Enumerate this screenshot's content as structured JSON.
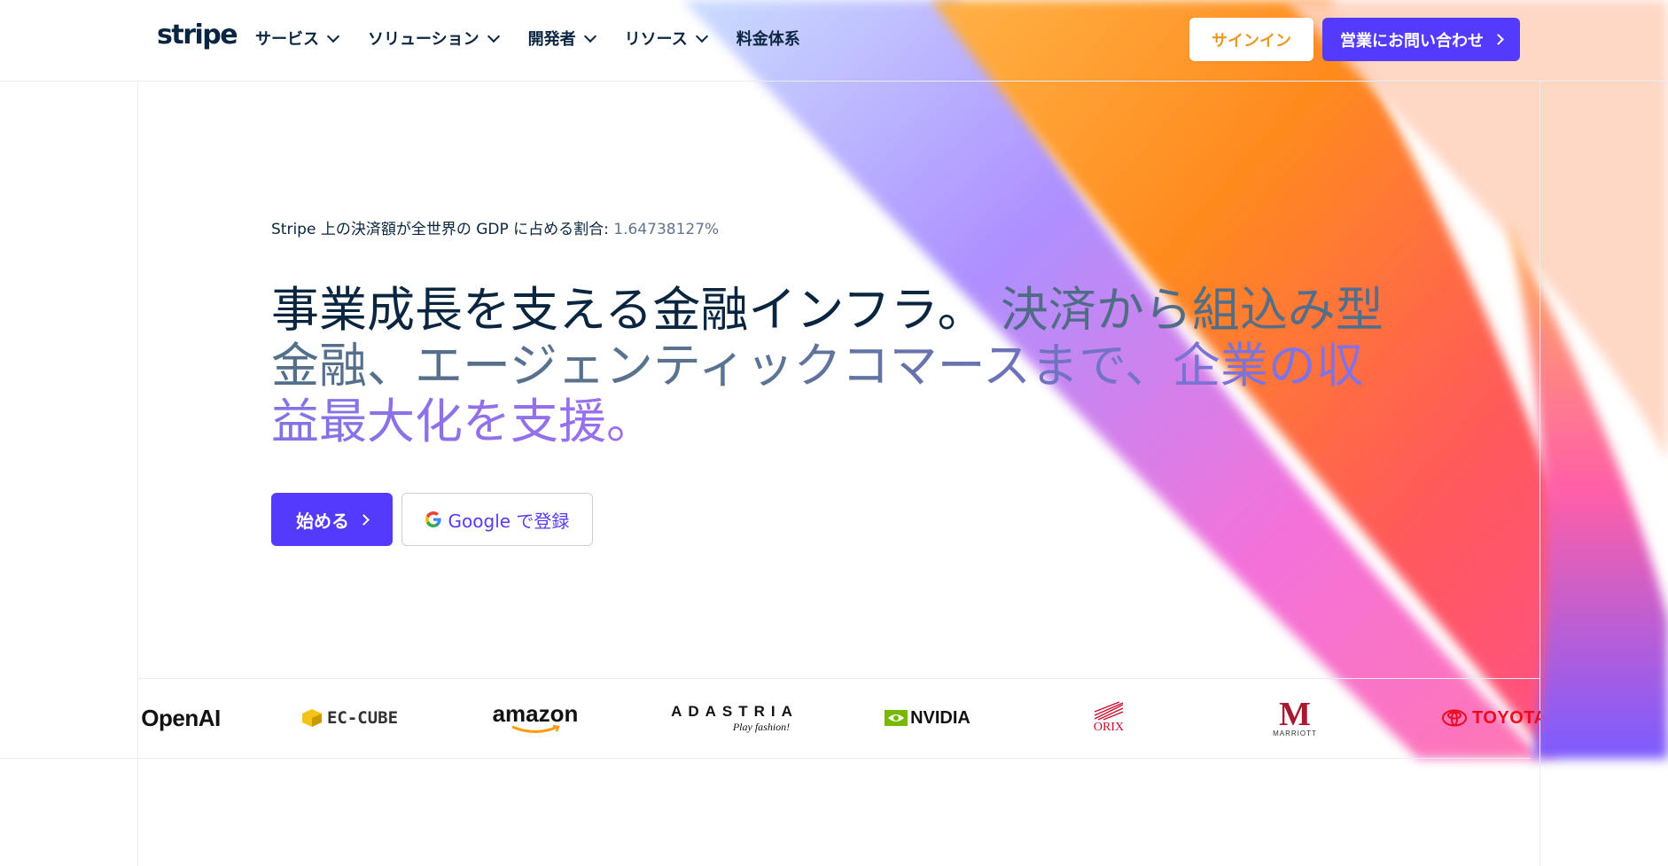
{
  "header": {
    "logo": "stripe",
    "nav": [
      {
        "label": "サービス"
      },
      {
        "label": "ソリューション"
      },
      {
        "label": "開発者"
      },
      {
        "label": "リソース"
      },
      {
        "label": "料金体系"
      }
    ],
    "signin_label": "サインイン",
    "contact_label": "営業にお問い合わせ"
  },
  "hero": {
    "gdp_label": "Stripe 上の決済額が全世界の GDP に占める割合:",
    "gdp_value": "1.64738127%",
    "headline_dark": "事業成長を支える金融インフラ。",
    "headline_light": "決済から組込み型金融、エージェンティックコマースまで、企業の収益最大化を支援。",
    "start_label": "始める",
    "google_label": "Google で登録"
  },
  "logos": [
    "OpenAI",
    "EC-CUBE",
    "amazon",
    "ADASTRIA",
    "NVIDIA",
    "ORIX",
    "MARRIOTT",
    "TOYOTA"
  ],
  "colors": {
    "brand": "#533afd",
    "text": "#0a2540",
    "signin_text": "#e89a26"
  }
}
